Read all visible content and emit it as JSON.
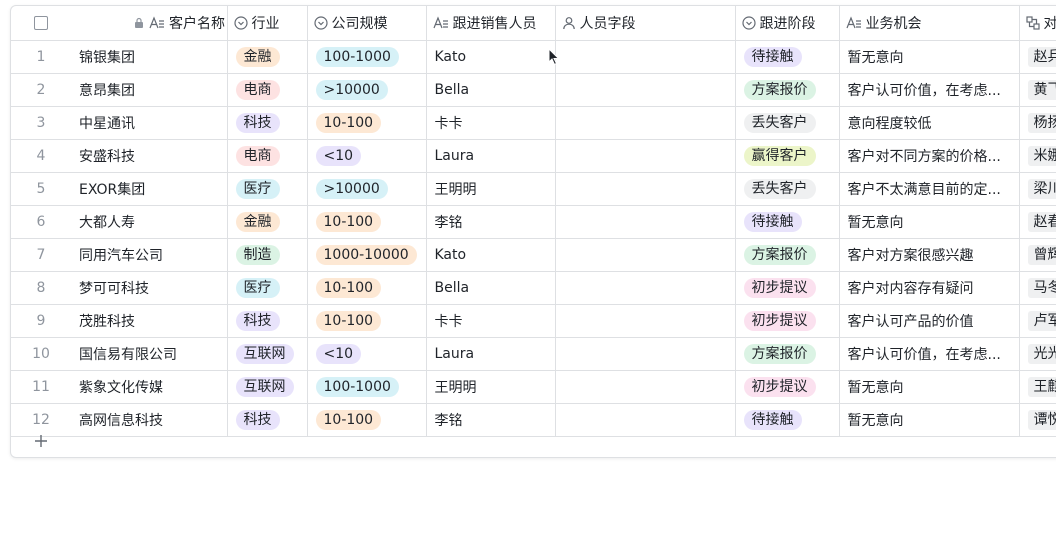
{
  "columns": {
    "name": "客户名称",
    "industry": "行业",
    "size": "公司规模",
    "sales": "跟进销售人员",
    "person": "人员字段",
    "stage": "跟进阶段",
    "opportunity": "业务机会",
    "contact": "对"
  },
  "colors": {
    "industry": {
      "金融": "#fde8d4",
      "电商": "#fde2e2",
      "科技": "#e8e3fb",
      "医疗": "#d6f1f7",
      "制造": "#dbf3e4",
      "互联网": "#e8e3fb"
    },
    "size": {
      "100-1000": "#d6f1f7",
      ">10000": "#d6f1f7",
      "10-100": "#fde8d4",
      "<10": "#e8e3fb",
      "1000-10000": "#fde8d4"
    },
    "stage": {
      "待接触": "#e8e3fb",
      "方案报价": "#dbf3e4",
      "丢失客户": "#eff0f1",
      "赢得客户": "#ecf5c9",
      "初步提议": "#fbe1ef"
    }
  },
  "rows": [
    {
      "idx": "1",
      "name": "锦银集团",
      "industry": "金融",
      "size": "100-1000",
      "sales": "Kato",
      "stage": "待接触",
      "opportunity": "暂无意向",
      "contact": "赵兵"
    },
    {
      "idx": "2",
      "name": "意昂集团",
      "industry": "电商",
      "size": ">10000",
      "sales": "Bella",
      "stage": "方案报价",
      "opportunity": "客户认可价值，在考虑...",
      "contact": "黄飞"
    },
    {
      "idx": "3",
      "name": "中星通讯",
      "industry": "科技",
      "size": "10-100",
      "sales": "卡卡",
      "stage": "丢失客户",
      "opportunity": "意向程度较低",
      "contact": "杨扬"
    },
    {
      "idx": "4",
      "name": "安盛科技",
      "industry": "电商",
      "size": "<10",
      "sales": "Laura",
      "stage": "赢得客户",
      "opportunity": "客户对不同方案的价格...",
      "contact": "米娜"
    },
    {
      "idx": "5",
      "name": "EXOR集团",
      "industry": "医疗",
      "size": ">10000",
      "sales": "王明明",
      "stage": "丢失客户",
      "opportunity": "客户不太满意目前的定...",
      "contact": "梁川"
    },
    {
      "idx": "6",
      "name": "大都人寿",
      "industry": "金融",
      "size": "10-100",
      "sales": "李铭",
      "stage": "待接触",
      "opportunity": "暂无意向",
      "contact": "赵春"
    },
    {
      "idx": "7",
      "name": "同用汽车公司",
      "industry": "制造",
      "size": "1000-10000",
      "sales": "Kato",
      "stage": "方案报价",
      "opportunity": "客户对方案很感兴趣",
      "contact": "曾辉"
    },
    {
      "idx": "8",
      "name": "梦可可科技",
      "industry": "医疗",
      "size": "10-100",
      "sales": "Bella",
      "stage": "初步提议",
      "opportunity": "客户对内容存有疑问",
      "contact": "马冬"
    },
    {
      "idx": "9",
      "name": "茂胜科技",
      "industry": "科技",
      "size": "10-100",
      "sales": "卡卡",
      "stage": "初步提议",
      "opportunity": "客户认可产品的价值",
      "contact": "卢军"
    },
    {
      "idx": "10",
      "name": "国信易有限公司",
      "industry": "互联网",
      "size": "<10",
      "sales": "Laura",
      "stage": "方案报价",
      "opportunity": "客户认可价值，在考虑...",
      "contact": "光光"
    },
    {
      "idx": "11",
      "name": "紫象文化传媒",
      "industry": "互联网",
      "size": "100-1000",
      "sales": "王明明",
      "stage": "初步提议",
      "opportunity": "暂无意向",
      "contact": "王麒"
    },
    {
      "idx": "12",
      "name": "高网信息科技",
      "industry": "科技",
      "size": "10-100",
      "sales": "李铭",
      "stage": "待接触",
      "opportunity": "暂无意向",
      "contact": "谭悦"
    }
  ]
}
